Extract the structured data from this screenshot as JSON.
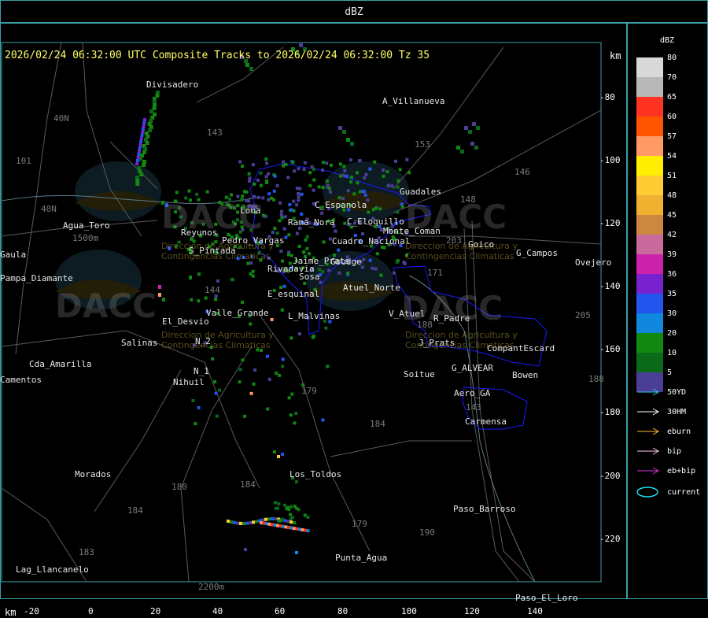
{
  "title": "dBZ",
  "header": {
    "timeline": "2026/02/24 06:32:00 UTC Composite Tracks to 2026/02/24 06:32:00 Tz 35",
    "km_label": "km"
  },
  "colors": {
    "frame": "#3aa0a8",
    "header_text": "#ffff66",
    "boundary": "#1a1aff",
    "roads": "#5a5a5a"
  },
  "axes": {
    "x_unit": "km",
    "x_ticks": [
      "-20",
      "0",
      "20",
      "40",
      "60",
      "80",
      "100",
      "120",
      "140"
    ],
    "y_ticks": [
      "-80",
      "-100",
      "-120",
      "-140",
      "-160",
      "-180",
      "-200",
      "-220"
    ]
  },
  "legend": {
    "title": "dBZ",
    "levels": [
      {
        "value": "80",
        "color": "#d8d8d8"
      },
      {
        "value": "70",
        "color": "#b8b8b8"
      },
      {
        "value": "65",
        "color": "#ff3322"
      },
      {
        "value": "60",
        "color": "#ff5500"
      },
      {
        "value": "57",
        "color": "#ff9966"
      },
      {
        "value": "54",
        "color": "#ffee00"
      },
      {
        "value": "51",
        "color": "#ffcc33"
      },
      {
        "value": "48",
        "color": "#f0b030"
      },
      {
        "value": "45",
        "color": "#cc8840"
      },
      {
        "value": "42",
        "color": "#c86a9c"
      },
      {
        "value": "39",
        "color": "#cc22aa"
      },
      {
        "value": "36",
        "color": "#7722cc"
      },
      {
        "value": "35",
        "color": "#2255ee"
      },
      {
        "value": "30",
        "color": "#1188dd"
      },
      {
        "value": "20",
        "color": "#118811"
      },
      {
        "value": "10",
        "color": "#0a6a1a"
      },
      {
        "value": "5",
        "color": "#4a3e96"
      }
    ],
    "tracks": [
      {
        "label": "50YD",
        "color": "#33ccdd"
      },
      {
        "label": "30HM",
        "color": "#ffffff"
      },
      {
        "label": "eburn",
        "color": "#ffbb33"
      },
      {
        "label": "bip",
        "color": "#ffccee"
      },
      {
        "label": "eb+bip",
        "color": "#dd33dd"
      },
      {
        "label": "current",
        "color": "#22ddee"
      }
    ]
  },
  "places": [
    {
      "name": "Divisadero"
    },
    {
      "name": "A_Villanueva"
    },
    {
      "name": "Guadales"
    },
    {
      "name": "Agua_Toro"
    },
    {
      "name": "Reyunos"
    },
    {
      "name": "S_Pintada"
    },
    {
      "name": "Goico"
    },
    {
      "name": "G_Campos"
    },
    {
      "name": "Ovejero"
    },
    {
      "name": "Pampa_Diamante"
    },
    {
      "name": "El_Desvio"
    },
    {
      "name": "Valle_Grande"
    },
    {
      "name": "L_Malvinas"
    },
    {
      "name": "E_esquinal"
    },
    {
      "name": "Salinas"
    },
    {
      "name": "N_2"
    },
    {
      "name": "N_1"
    },
    {
      "name": "Nihuil"
    },
    {
      "name": "Cda_Amarilla"
    },
    {
      "name": "Camentos"
    },
    {
      "name": "V_Atuel"
    },
    {
      "name": "R_Padre"
    },
    {
      "name": "J_Prats"
    },
    {
      "name": "CompantEscard"
    },
    {
      "name": "G_ALVEAR"
    },
    {
      "name": "Soitue"
    },
    {
      "name": "Bowen"
    },
    {
      "name": "Aero_GA"
    },
    {
      "name": "Carmensa"
    },
    {
      "name": "Morados"
    },
    {
      "name": "Los_Toldos"
    },
    {
      "name": "Paso_Barroso"
    },
    {
      "name": "Lag_Llancanelo"
    },
    {
      "name": "Punta_Agua"
    },
    {
      "name": "Paso_El_Loro"
    },
    {
      "name": "C_Espanola"
    },
    {
      "name": "Monte_Coman"
    },
    {
      "name": "C_Eloquillo"
    },
    {
      "name": "Rama_Nora"
    },
    {
      "name": "Cuadro_Nacional"
    },
    {
      "name": "Goudge"
    },
    {
      "name": "Atuel_Norte"
    },
    {
      "name": "Rivadavia"
    },
    {
      "name": "Sosa"
    },
    {
      "name": "Pedro_Vargas"
    },
    {
      "name": "Jaime_Prats"
    },
    {
      "name": "Loma"
    },
    {
      "name": "Gaula"
    }
  ],
  "routes": [
    "143",
    "153",
    "146",
    "101",
    "148",
    "203",
    "171",
    "40N",
    "40N",
    "144",
    "188",
    "184",
    "179",
    "184",
    "180",
    "184",
    "183",
    "179",
    "190",
    "143",
    "205",
    "188",
    "1500m",
    "2200m"
  ],
  "watermark": {
    "brand": "DACC",
    "tagline": "Direccion de Agricultura y Contingencias Climaticas"
  }
}
